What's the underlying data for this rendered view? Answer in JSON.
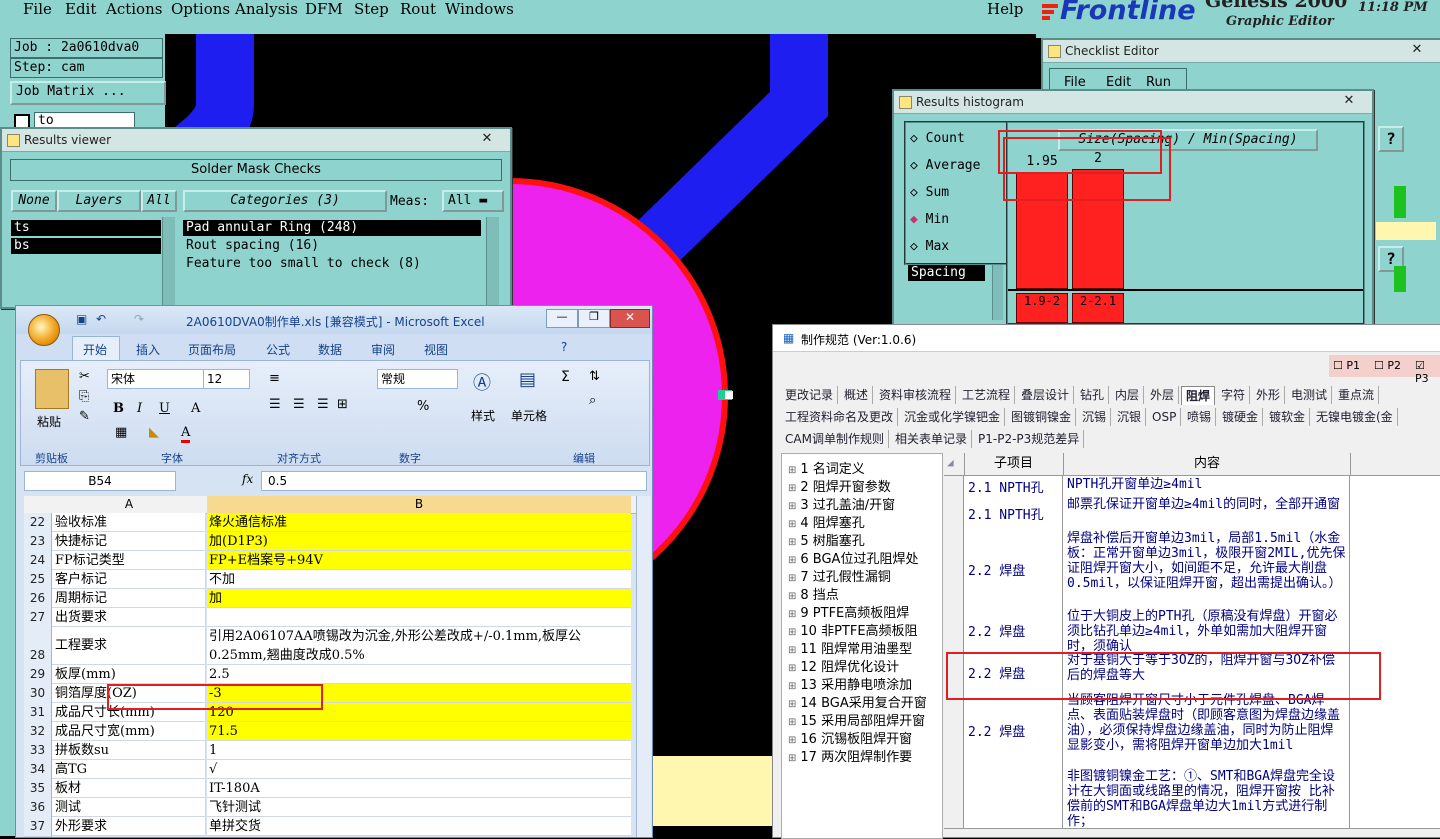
{
  "genesis": {
    "menu": [
      "File",
      "Edit",
      "Actions",
      "Options",
      "Analysis",
      "DFM",
      "Step",
      "Rout",
      "Windows"
    ],
    "help": "Help",
    "brand": "Frontline",
    "product": "Genesis 2000",
    "subtitle": "Graphic Editor",
    "time": "11:18 PM",
    "job": "Job : 2a0610dva0",
    "step": "Step: cam",
    "job_matrix": "Job Matrix ...",
    "to_label": "to"
  },
  "results_viewer": {
    "title": "Results viewer",
    "header": "Solder Mask Checks",
    "none_btn": "None",
    "layers_btn": "Layers",
    "all_btn": "All",
    "categories_btn": "Categories (3)",
    "meas_label": "Meas:",
    "meas_value": "All",
    "layers": [
      "ts",
      "bs"
    ],
    "categories": [
      "Pad annular Ring (248)",
      "Rout spacing (16)",
      "Feature too small to check (8)"
    ]
  },
  "histogram": {
    "title": "Results histogram",
    "options": [
      "Count",
      "Average",
      "Sum",
      "Min",
      "Max"
    ],
    "selected": "Min",
    "metric": "Spacing",
    "header": "Size(Spacing) / Min(Spacing)",
    "bars": [
      {
        "value": 1.95,
        "value_label": "1.95",
        "range_label": "1.9-2"
      },
      {
        "value": 2,
        "value_label": "2",
        "range_label": "2-2.1"
      }
    ]
  },
  "checklist": {
    "title": "Checklist Editor",
    "menu": [
      "File",
      "Edit",
      "Run"
    ],
    "help_glyph": "?"
  },
  "excel": {
    "title": "2A0610DVA0制作单.xls  [兼容模式] - Microsoft Excel",
    "tabs": [
      "开始",
      "插入",
      "页面布局",
      "公式",
      "数据",
      "审阅",
      "视图"
    ],
    "font_name": "宋体",
    "font_size": "12",
    "number_format": "常规",
    "groups": [
      "剪贴板",
      "字体",
      "对齐方式",
      "数字",
      "编辑"
    ],
    "paste": "粘贴",
    "styles": "样式",
    "cells": "单元格",
    "name_box": "B54",
    "formula": "0.5",
    "col_a": "A",
    "col_b": "B",
    "rows": [
      {
        "n": "22",
        "a": "验收标准",
        "b": "烽火通信标准",
        "y": true
      },
      {
        "n": "23",
        "a": "快捷标记",
        "b": "加(D1P3)",
        "y": true
      },
      {
        "n": "24",
        "a": "FP标记类型",
        "b": "FP+E档案号+94V",
        "y": true
      },
      {
        "n": "25",
        "a": "客户标记",
        "b": "不加",
        "y": false
      },
      {
        "n": "26",
        "a": "周期标记",
        "b": "加",
        "y": true
      },
      {
        "n": "27",
        "a": "出货要求",
        "b": "",
        "y": false
      },
      {
        "n": "28",
        "a": "工程要求",
        "b": "引用2A06107AA喷锡改为沉金,外形公差改成+/-0.1mm,板厚公",
        "b2": "0.25mm,翘曲度改成0.5%",
        "y": false
      },
      {
        "n": "29",
        "a": "板厚(mm)",
        "b": "2.5",
        "y": false
      },
      {
        "n": "30",
        "a": "铜箔厚度(OZ)",
        "b": "-3",
        "y": true
      },
      {
        "n": "31",
        "a": "成品尺寸长(mm)",
        "b": "120",
        "y": true
      },
      {
        "n": "32",
        "a": "成品尺寸宽(mm)",
        "b": "71.5",
        "y": true
      },
      {
        "n": "33",
        "a": "拼板数su",
        "b": "1",
        "y": false
      },
      {
        "n": "34",
        "a": "高TG",
        "b": "√",
        "y": false
      },
      {
        "n": "35",
        "a": "板材",
        "b": "IT-180A",
        "y": false
      },
      {
        "n": "36",
        "a": "测试",
        "b": "飞针测试",
        "y": false
      },
      {
        "n": "37",
        "a": "外形要求",
        "b": "单拼交货",
        "y": false
      }
    ]
  },
  "spec": {
    "title": "制作规范 (Ver:1.0.6)",
    "checks": [
      "P1",
      "P2",
      "P3"
    ],
    "tabs_row1": [
      "更改记录",
      "概述",
      "资料审核流程",
      "工艺流程",
      "叠层设计",
      "钻孔",
      "内层",
      "外层",
      "阻焊",
      "字符",
      "外形",
      "电测试",
      "重点流"
    ],
    "tabs_row2": [
      "工程资料命名及更改",
      "沉金或化学镍钯金",
      "图镀铜镍金",
      "沉锡",
      "沉银",
      "OSP",
      "喷锡",
      "镀硬金",
      "镀软金",
      "无镍电镀金(金"
    ],
    "tabs_row3": [
      "CAM调单制作规则",
      "相关表单记录",
      "P1-P2-P3规范差异"
    ],
    "active_tab": "阻焊",
    "tree": [
      "1 名词定义",
      "2 阻焊开窗参数",
      "3 过孔盖油/开窗",
      "4 阻焊塞孔",
      "5 树脂塞孔",
      "6 BGA位过孔阻焊处",
      "7 过孔假性漏铜",
      "8 挡点",
      "9 PTFE高频板阻焊",
      "10 非PTFE高频板阻",
      "11 阻焊常用油墨型",
      "12 阻焊优化设计",
      "13 采用静电喷涂加",
      "14 BGA采用复合开窗",
      "15 采用局部阻焊开窗",
      "16 沉锡板阻焊开窗",
      "17 两次阻焊制作要"
    ],
    "col_sub": "子项目",
    "col_content": "内容",
    "rows": [
      {
        "sub": "2.1 NPTH孔",
        "content": "NPTH孔开窗单边≥4mil"
      },
      {
        "sub": "2.1 NPTH孔",
        "content": "邮票孔保证开窗单边≥4mil的同时，全部开通窗"
      },
      {
        "sub": "2.2 焊盘",
        "content": "焊盘补偿后开窗单边3mil，局部1.5mil（水金板：正常开窗单边3mil，极限开窗2MIL,优先保证阻焊开窗大小，如间距不足，允许最大削盘0.5mil，以保证阻焊开窗，超出需提出确认。）"
      },
      {
        "sub": "2.2 焊盘",
        "content": "位于大铜皮上的PTH孔（原稿没有焊盘）开窗必须比钻孔单边≥4mil，外单如需加大阻焊开窗时，须确认"
      },
      {
        "sub": "2.2 焊盘",
        "content": "对于基铜大于等于3OZ的，阻焊开窗与3OZ补偿后的焊盘等大"
      },
      {
        "sub": "2.2 焊盘",
        "content": "当顾客阻焊开窗尺寸小于元件孔焊盘、BGA焊点、表面贴装焊盘时（即顾客意图为焊盘边缘盖油），必须保持焊盘边缘盖油，同时为防止阻焊显影变小，需将阻焊开窗单边加大1mil"
      },
      {
        "sub": "",
        "content": "非图镀铜镍金工艺：①、SMT和BGA焊盘完全设计在大铜面或线路里的情况，阻焊开窗按 比补偿前的SMT和BGA焊盘单边大1mil方式进行制作；"
      }
    ]
  }
}
